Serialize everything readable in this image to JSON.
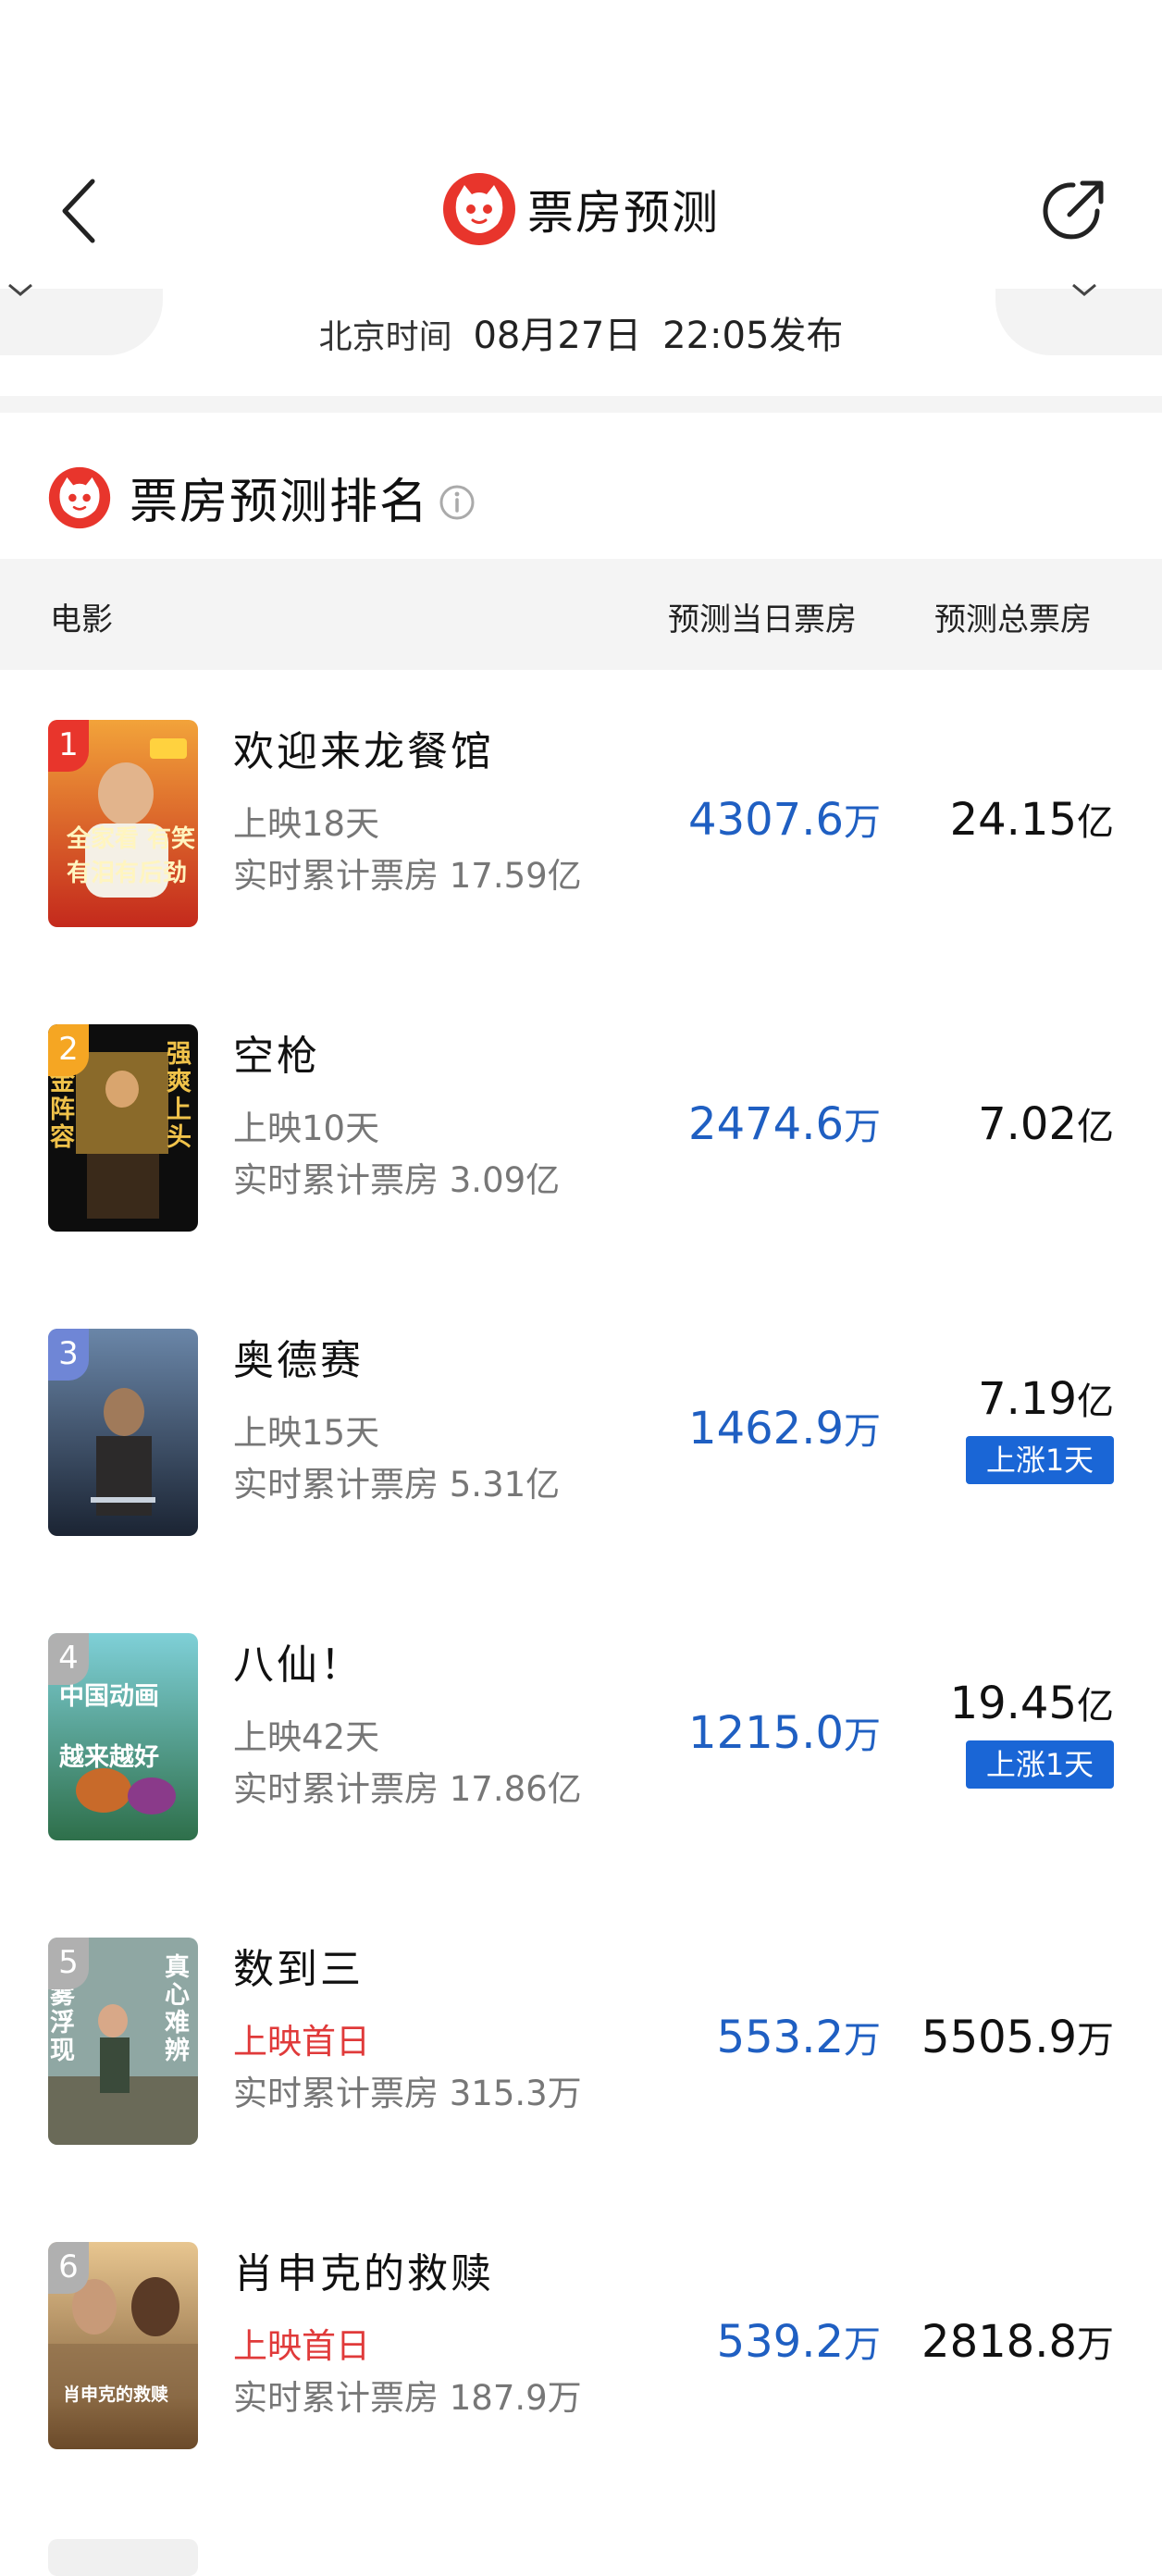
{
  "header": {
    "title": "票房预测",
    "publish_label": "北京时间",
    "publish_date": "08月27日",
    "publish_time": "22:05发布"
  },
  "section": {
    "title": "票房预测排名"
  },
  "columns": {
    "movie": "电影",
    "daily": "预测当日票房",
    "total": "预测总票房"
  },
  "movies": [
    {
      "rank": "1",
      "title": "欢迎来龙餐馆",
      "days": "上映18天",
      "cumulative": "实时累计票房 17.59亿",
      "daily_value": "4307.6",
      "daily_unit": "万",
      "total_value": "24.15",
      "total_unit": "亿",
      "tag": "",
      "poster_text": "全家看 有笑有泪有后劲"
    },
    {
      "rank": "2",
      "title": "空枪",
      "days": "上映10天",
      "cumulative": "实时累计票房 3.09亿",
      "daily_value": "2474.6",
      "daily_unit": "万",
      "total_value": "7.02",
      "total_unit": "亿",
      "tag": "",
      "poster_text_left": "黄金阵容",
      "poster_text_right": "强爽上头"
    },
    {
      "rank": "3",
      "title": "奥德赛",
      "days": "上映15天",
      "cumulative": "实时累计票房 5.31亿",
      "daily_value": "1462.9",
      "daily_unit": "万",
      "total_value": "7.19",
      "total_unit": "亿",
      "tag": "上涨1天"
    },
    {
      "rank": "4",
      "title": "八仙！",
      "days": "上映42天",
      "cumulative": "实时累计票房 17.86亿",
      "daily_value": "1215.0",
      "daily_unit": "万",
      "total_value": "19.45",
      "total_unit": "亿",
      "tag": "上涨1天",
      "poster_text": "中国动画 越来越好"
    },
    {
      "rank": "5",
      "title": "数到三",
      "days": "上映首日",
      "cumulative": "实时累计票房 315.3万",
      "daily_value": "553.2",
      "daily_unit": "万",
      "total_value": "5505.9",
      "total_unit": "万",
      "tag": "",
      "poster_text_left": "迷雾浮现",
      "poster_text_right": "真心难辨"
    },
    {
      "rank": "6",
      "title": "肖申克的救赎",
      "days": "上映首日",
      "cumulative": "实时累计票房 187.9万",
      "daily_value": "539.2",
      "daily_unit": "万",
      "total_value": "2818.8",
      "total_unit": "万",
      "tag": "",
      "poster_text": "肖申克的救赎"
    }
  ],
  "colors": {
    "accent_blue": "#1f5fc2",
    "tag_blue": "#1a66d6",
    "first_day_red": "#e03a3a",
    "brand_red": "#e8352c"
  }
}
